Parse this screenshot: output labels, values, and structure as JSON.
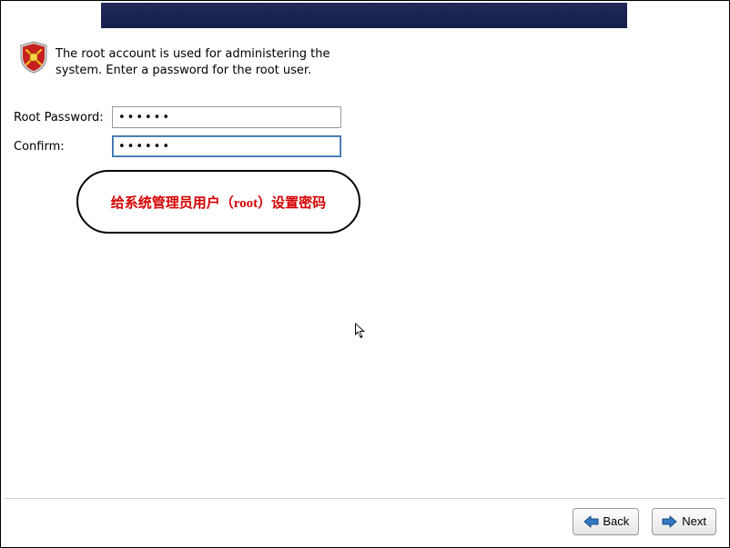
{
  "header": {
    "description": "The root account is used for administering the system.  Enter a password for the root user."
  },
  "form": {
    "root_password_label": "Root Password:",
    "confirm_label": "Confirm:",
    "root_password_value": "••••••",
    "confirm_value": "••••••"
  },
  "annotation": {
    "text": "给系统管理员用户（root）设置密码"
  },
  "buttons": {
    "back_label": "Back",
    "next_label": "Next"
  }
}
